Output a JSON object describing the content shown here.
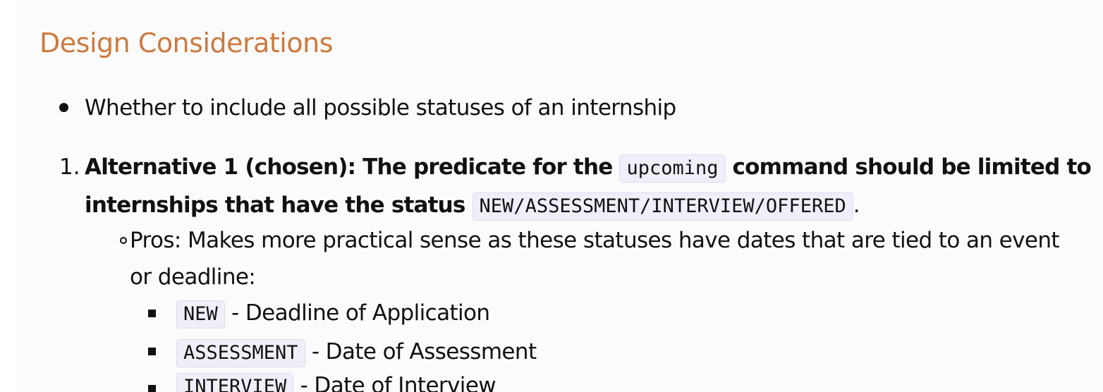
{
  "heading": "Design Considerations",
  "bullet1": "Whether to include all possible statuses of an internship",
  "alt1": {
    "number": "1.",
    "text_a": "Alternative 1 (chosen): The predicate for the",
    "code_a": "upcoming",
    "text_b": "command should be limited to",
    "text_c": "internships that have the status",
    "code_b": "NEW/ASSESSMENT/INTERVIEW/OFFERED",
    "text_d": "."
  },
  "pros": {
    "line1": "Pros: Makes more practical sense as these statuses have dates that are tied to an event",
    "line2": "or deadline:"
  },
  "items": [
    {
      "code": "NEW",
      "text": "- Deadline of Application"
    },
    {
      "code": "ASSESSMENT",
      "text": "- Date of Assessment"
    },
    {
      "code": "INTERVIEW",
      "text": "- Date of Interview"
    }
  ]
}
